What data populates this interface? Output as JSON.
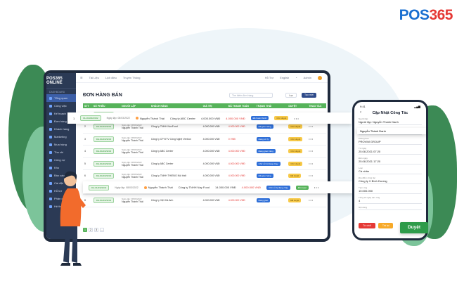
{
  "brand": {
    "logo_prefix": "POS",
    "logo_number": "365"
  },
  "app": {
    "brand": "POS365 ONLINE",
    "sidebar": {
      "section": "DASHBOARD",
      "items": [
        "Tổng quan",
        "Công việc",
        "Kế hoạch",
        "Đơn hàng",
        "Khách hàng",
        "Marketing",
        "Mua hàng",
        "Thu chi",
        "Công nợ",
        "Kho",
        "Báo cáo",
        "Cài đặt",
        "Hỗ trợ",
        "Phân quyền",
        "Hệ thống"
      ]
    },
    "topbar": {
      "items": [
        "Tài Liệu",
        "Lịch điều",
        "Truyền Thông"
      ],
      "right": [
        "Hỗ Trợ",
        "English",
        "Admin"
      ]
    },
    "page_title": "ĐƠN HÀNG BÁN",
    "search_placeholder": "Tìm kiếm đơn hàng",
    "btn_location": "Lọc",
    "btn_add": "Tạo mới",
    "table": {
      "headers": [
        "STT",
        "SỐ PHIẾU",
        "NGƯỜI LẬP",
        "KHÁCH HÀNG",
        "GIÁ TRỊ",
        "ĐÃ THANH TOÁN",
        "TRẠNG THÁI",
        "DUYỆT",
        "THAO TÁC"
      ],
      "rows": [
        {
          "stt": "1",
          "code": "DH-DH0323232",
          "date": "Ngày lập: 08/03/2022",
          "user": "Nguyễn Thành Thái",
          "customer": "Công ty ABC Center",
          "value": "4.000.000 VNĐ",
          "paid": "4.000.000 VNĐ",
          "status": "Đã hoàn thành",
          "approve": "Chờ duyệt",
          "action": "• • •"
        },
        {
          "stt": "2",
          "code": "DH-DH0323232",
          "date": "Ngày lập: 08/03/2022",
          "user": "Nguyễn Thành Thái",
          "customer": "Công ty TNHH NovFood",
          "value": "4.000.000 VNĐ",
          "paid": "4.000.000 VNĐ",
          "status": "Đã giao hàng",
          "approve": "Chờ duyệt",
          "action": "• • •"
        },
        {
          "stt": "3",
          "code": "DH-DH0323232",
          "date": "Ngày lập: 08/03/2022",
          "user": "Nguyễn Thành Thái",
          "customer": "Công ty CP ĐTV Công Nghệ Vention",
          "value": "4.000.000 VNĐ",
          "paid": "0 VNĐ",
          "status": "Đang xử lý",
          "approve": "Chờ duyệt",
          "action": "• • •"
        },
        {
          "stt": "4",
          "code": "DH-DH0323232",
          "date": "Ngày lập: 08/03/2022",
          "user": "Nguyễn Thành Thái",
          "customer": "Công ty ABC Center",
          "value": "4.000.000 VNĐ",
          "paid": "4.000.000 VNĐ",
          "status": "Đang giao hàng",
          "approve": "Chờ duyệt",
          "action": "• • •"
        },
        {
          "stt": "5",
          "code": "DH-DH0323232",
          "date": "Ngày lập: 08/03/2022",
          "user": "Nguyễn Thành Thái",
          "customer": "Công ty ABC Center",
          "value": "4.000.000 VNĐ",
          "paid": "4.000.000 VNĐ",
          "status": "Chờ xử lý đang chạy",
          "approve": "Chờ duyệt",
          "action": "• • •"
        },
        {
          "stt": "6",
          "code": "DH-DH0323232",
          "date": "Ngày lập: 08/03/2022",
          "user": "Nguyễn Thành Thái",
          "customer": "Công ty TNHH THIENG Nội thất",
          "value": "4.000.000 VNĐ",
          "paid": "4.000.000 VNĐ",
          "status": "Đã giao hàng",
          "approve": "Đã duyệt",
          "action": "• • •"
        },
        {
          "stt": "7",
          "code": "DH-DH0323232",
          "date": "Ngày lập: 08/03/2022",
          "user": "Nguyễn Thành Thái",
          "customer": "Công ty TNHH NovFood",
          "value": "14.000.000 VNĐ",
          "paid": "4.000.000 VNĐ",
          "status": "Chờ xử lý đang chạy",
          "approve": "Đã duyệt",
          "action": "• • •"
        },
        {
          "stt": "8",
          "code": "DH-DH0323232",
          "date": "Ngày lập: 08/03/2022",
          "user": "Nguyễn Thành Thái",
          "customer": "Công ty Việt Hà Anh",
          "value": "4.000.000 VNĐ",
          "paid": "4.000.000 VNĐ",
          "status": "Đang giao",
          "approve": "Đã duyệt",
          "action": "• • •"
        }
      ]
    },
    "pager": [
      "1",
      "2",
      "3",
      "..."
    ]
  },
  "float_row_1": {
    "stt": "1",
    "code": "DH-DH0323232",
    "date": "Ngày lập: 08/03/2022",
    "user": "Nguyễn Thành Thái",
    "customer": "Công ty ABC Center",
    "value": "4.000.000 VNĐ",
    "paid": "4.000.000 VNĐ",
    "status": "Đã hoàn thành",
    "approve": "Chờ duyệt",
    "action": "• • •"
  },
  "float_row_2": {
    "code": "DH-DH0323232",
    "date": "Ngày lập: 08/03/2022",
    "user": "Nguyễn Thành Thái",
    "customer": "Công ty TNHH Nay Food",
    "value": "14.000.000 VNĐ",
    "paid": "4.000.000 VNĐ",
    "status": "Chờ xử lý đang chạy",
    "approve": "Đã duyệt",
    "action": "• • •"
  },
  "phone": {
    "time": "9:41",
    "title": "Cập Nhật Công Tác",
    "fields": [
      {
        "label": "Người lập",
        "value": "Người lập: Nguyễn Thành Danh"
      },
      {
        "label": "Nhân viên",
        "value": "Nguyễn Thành Danh"
      },
      {
        "label": "Phòng ban",
        "value": "PROVIM GROUP"
      },
      {
        "label": "Từ ngày",
        "value": "25.08.2021 07:20"
      },
      {
        "label": "Đến ngày",
        "value": "25.08.2021 17:20"
      },
      {
        "label": "Loại",
        "value": "Cá nhân"
      },
      {
        "label": "Địa điểm công tác",
        "value": "Công ty X Bình Dương"
      },
      {
        "label": "Tạm ứng",
        "value": "10.000.000"
      },
      {
        "label": "Tổng số ngày tạm ứng",
        "value": "4"
      },
      {
        "label": "Nội dung",
        "value": ""
      }
    ],
    "btn_cancel": "Từ chối",
    "btn_return": "Trả lại"
  },
  "float_employee": "Nguyễn Thành Danh",
  "approve_button": "Duyệt",
  "colors": {
    "accent_green": "#56b35a",
    "primary_blue": "#2f4b8a",
    "approve_green": "#2e9b4a"
  }
}
